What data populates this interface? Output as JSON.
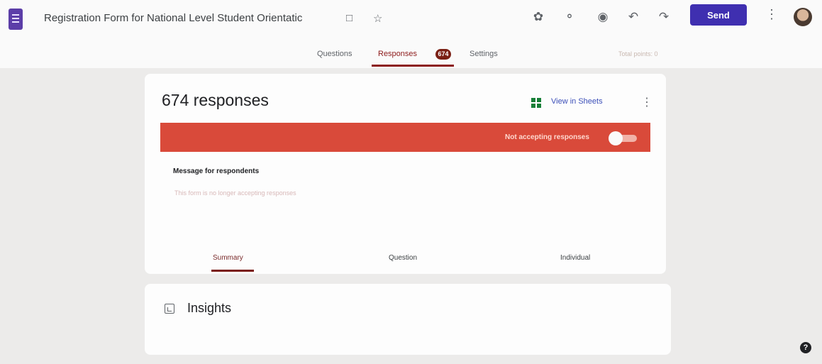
{
  "header": {
    "title": "Registration Form for National Level Student Orientatic",
    "send_label": "Send",
    "icons": [
      "forms-icon",
      "folder-icon",
      "star-icon",
      "customize-theme-icon",
      "palette-icon",
      "preview-icon",
      "undo-icon",
      "redo-icon",
      "more-icon",
      "avatar"
    ]
  },
  "tabs": {
    "questions": "Questions",
    "responses": "Responses",
    "responses_count": "674",
    "settings": "Settings",
    "total_points": "Total points: 0"
  },
  "responses_card": {
    "count_label": "674 responses",
    "view_in_sheets": "View in Sheets",
    "banner_text": "Not accepting responses",
    "accepting_responses": false,
    "message_label": "Message for respondents",
    "message_value": "This form is no longer accepting responses"
  },
  "subtabs": {
    "summary": "Summary",
    "question": "Question",
    "individual": "Individual",
    "active": "summary"
  },
  "insights": {
    "title": "Insights"
  },
  "help": {
    "glyph": "?"
  },
  "colors": {
    "accent": "#3f2fb0",
    "banner": "#d94a3a",
    "active_tab": "#8c1a1a"
  }
}
